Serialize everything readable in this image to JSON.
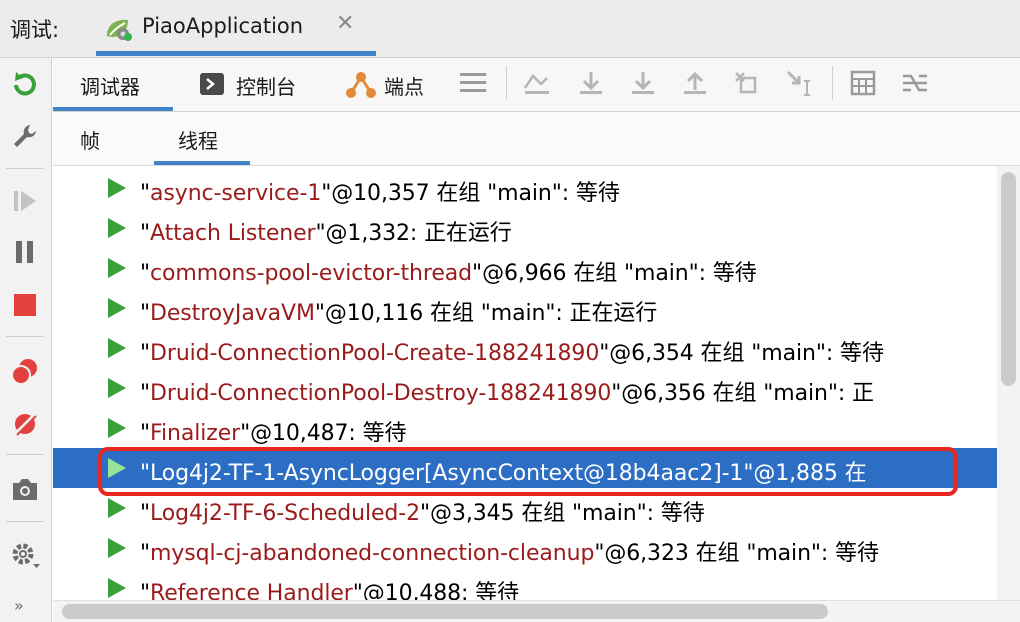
{
  "topbar": {
    "debug_label": "调试:",
    "app_name": "PiaoApplication",
    "close_glyph": "✕"
  },
  "left_tools": [
    {
      "name": "rerun-icon"
    },
    {
      "name": "wrench-icon"
    },
    {
      "name": "resume-icon"
    },
    {
      "name": "pause-icon"
    },
    {
      "name": "stop-icon"
    },
    {
      "name": "view-breakpoints-icon"
    },
    {
      "name": "mute-breakpoints-icon"
    },
    {
      "name": "camera-icon"
    },
    {
      "name": "settings-icon"
    },
    {
      "name": "expand-icon"
    }
  ],
  "toolbar": {
    "tabs": [
      {
        "label": "调试器"
      },
      {
        "label": "控制台"
      },
      {
        "label": "端点"
      }
    ]
  },
  "subtabs": {
    "frames": "帧",
    "threads": "线程"
  },
  "threads": [
    {
      "name": "async-service-1",
      "rest": "@10,357 在组 \"main\": 等待"
    },
    {
      "name": "Attach Listener",
      "rest": "@1,332: 正在运行"
    },
    {
      "name": "commons-pool-evictor-thread",
      "rest": "@6,966 在组 \"main\": 等待"
    },
    {
      "name": "DestroyJavaVM",
      "rest": "@10,116 在组 \"main\": 正在运行"
    },
    {
      "name": "Druid-ConnectionPool-Create-188241890",
      "rest": "@6,354 在组 \"main\": 等待"
    },
    {
      "name": "Druid-ConnectionPool-Destroy-188241890",
      "rest": "@6,356 在组 \"main\": 正"
    },
    {
      "name": "Finalizer",
      "rest": "@10,487: 等待"
    },
    {
      "name": "Log4j2-TF-1-AsyncLogger[AsyncContext@18b4aac2]-1",
      "rest": "@1,885 在"
    },
    {
      "name": "Log4j2-TF-6-Scheduled-2",
      "rest": "@3,345 在组 \"main\": 等待"
    },
    {
      "name": "mysql-cj-abandoned-connection-cleanup",
      "rest": "@6,323 在组 \"main\": 等待"
    },
    {
      "name": "Reference Handler",
      "rest": "@10,488: 等待"
    }
  ],
  "selected_thread_index": 7,
  "colors": {
    "accent": "#4083c9",
    "selection": "#2c6ec4",
    "thread_name": "#9a1b1b",
    "highlight": "#e8251f",
    "play": "#3aa13a"
  }
}
